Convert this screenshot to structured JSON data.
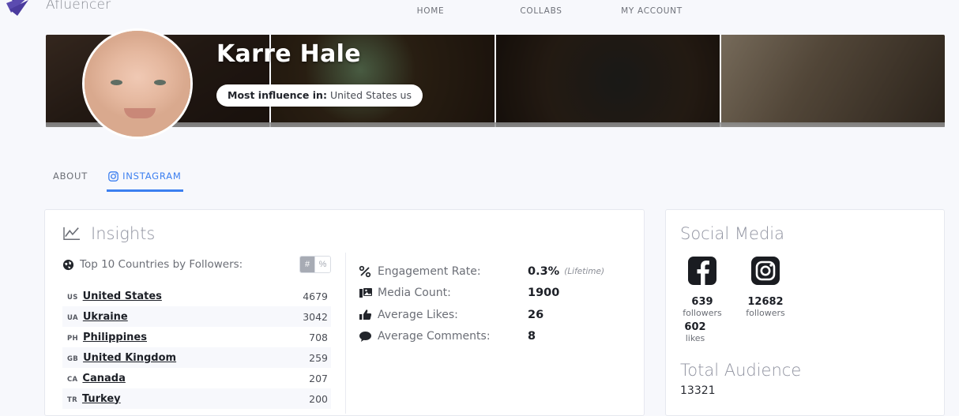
{
  "brand": {
    "name": "Afluencer",
    "logo_icon": "afluencer-logo"
  },
  "nav": [
    {
      "label": "HOME",
      "icon": "briefcase-icon"
    },
    {
      "label": "COLLABS",
      "icon": "handshake-icon"
    },
    {
      "label": "MY ACCOUNT",
      "icon": "user-circle-icon"
    }
  ],
  "profile": {
    "name": "Karre Hale",
    "influence_label": "Most influence in:",
    "influence_value": "United States us"
  },
  "tabs": [
    {
      "label": "ABOUT",
      "active": false,
      "icon": ""
    },
    {
      "label": "INSTAGRAM",
      "active": true,
      "icon": "instagram-icon"
    }
  ],
  "insights": {
    "title": "Insights",
    "title_icon": "chart-line-icon",
    "countries_label": "Top 10 Countries by Followers:",
    "countries_icon": "globe-icon",
    "unit_toggle": {
      "hash": "#",
      "percent": "%",
      "active": "hash"
    },
    "countries": [
      {
        "code": "US",
        "name": "United States",
        "value": "4679"
      },
      {
        "code": "UA",
        "name": "Ukraine",
        "value": "3042"
      },
      {
        "code": "PH",
        "name": "Philippines",
        "value": "708"
      },
      {
        "code": "GB",
        "name": "United Kingdom",
        "value": "259"
      },
      {
        "code": "CA",
        "name": "Canada",
        "value": "207"
      },
      {
        "code": "TR",
        "name": "Turkey",
        "value": "200"
      }
    ],
    "stats": [
      {
        "icon": "percent-icon",
        "label": "Engagement Rate:",
        "value": "0.3%",
        "note": "(Lifetime)"
      },
      {
        "icon": "media-icon",
        "label": "Media Count:",
        "value": "1900",
        "note": ""
      },
      {
        "icon": "thumbsup-icon",
        "label": "Average Likes:",
        "value": "26",
        "note": ""
      },
      {
        "icon": "comment-icon",
        "label": "Average Comments:",
        "value": "8",
        "note": ""
      }
    ]
  },
  "social": {
    "title": "Social Media",
    "facebook": {
      "icon": "facebook-icon",
      "followers": "639",
      "followers_label": "followers",
      "likes": "602",
      "likes_label": "likes"
    },
    "instagram": {
      "icon": "instagram-icon",
      "followers": "12682",
      "followers_label": "followers"
    },
    "audience_title": "Total Audience",
    "audience_value": "13321"
  },
  "colors": {
    "accent": "#3c7ff0",
    "brand": "#4b3b9e",
    "page_bg": "#f7f8fc",
    "card_bg": "#ffffff"
  }
}
